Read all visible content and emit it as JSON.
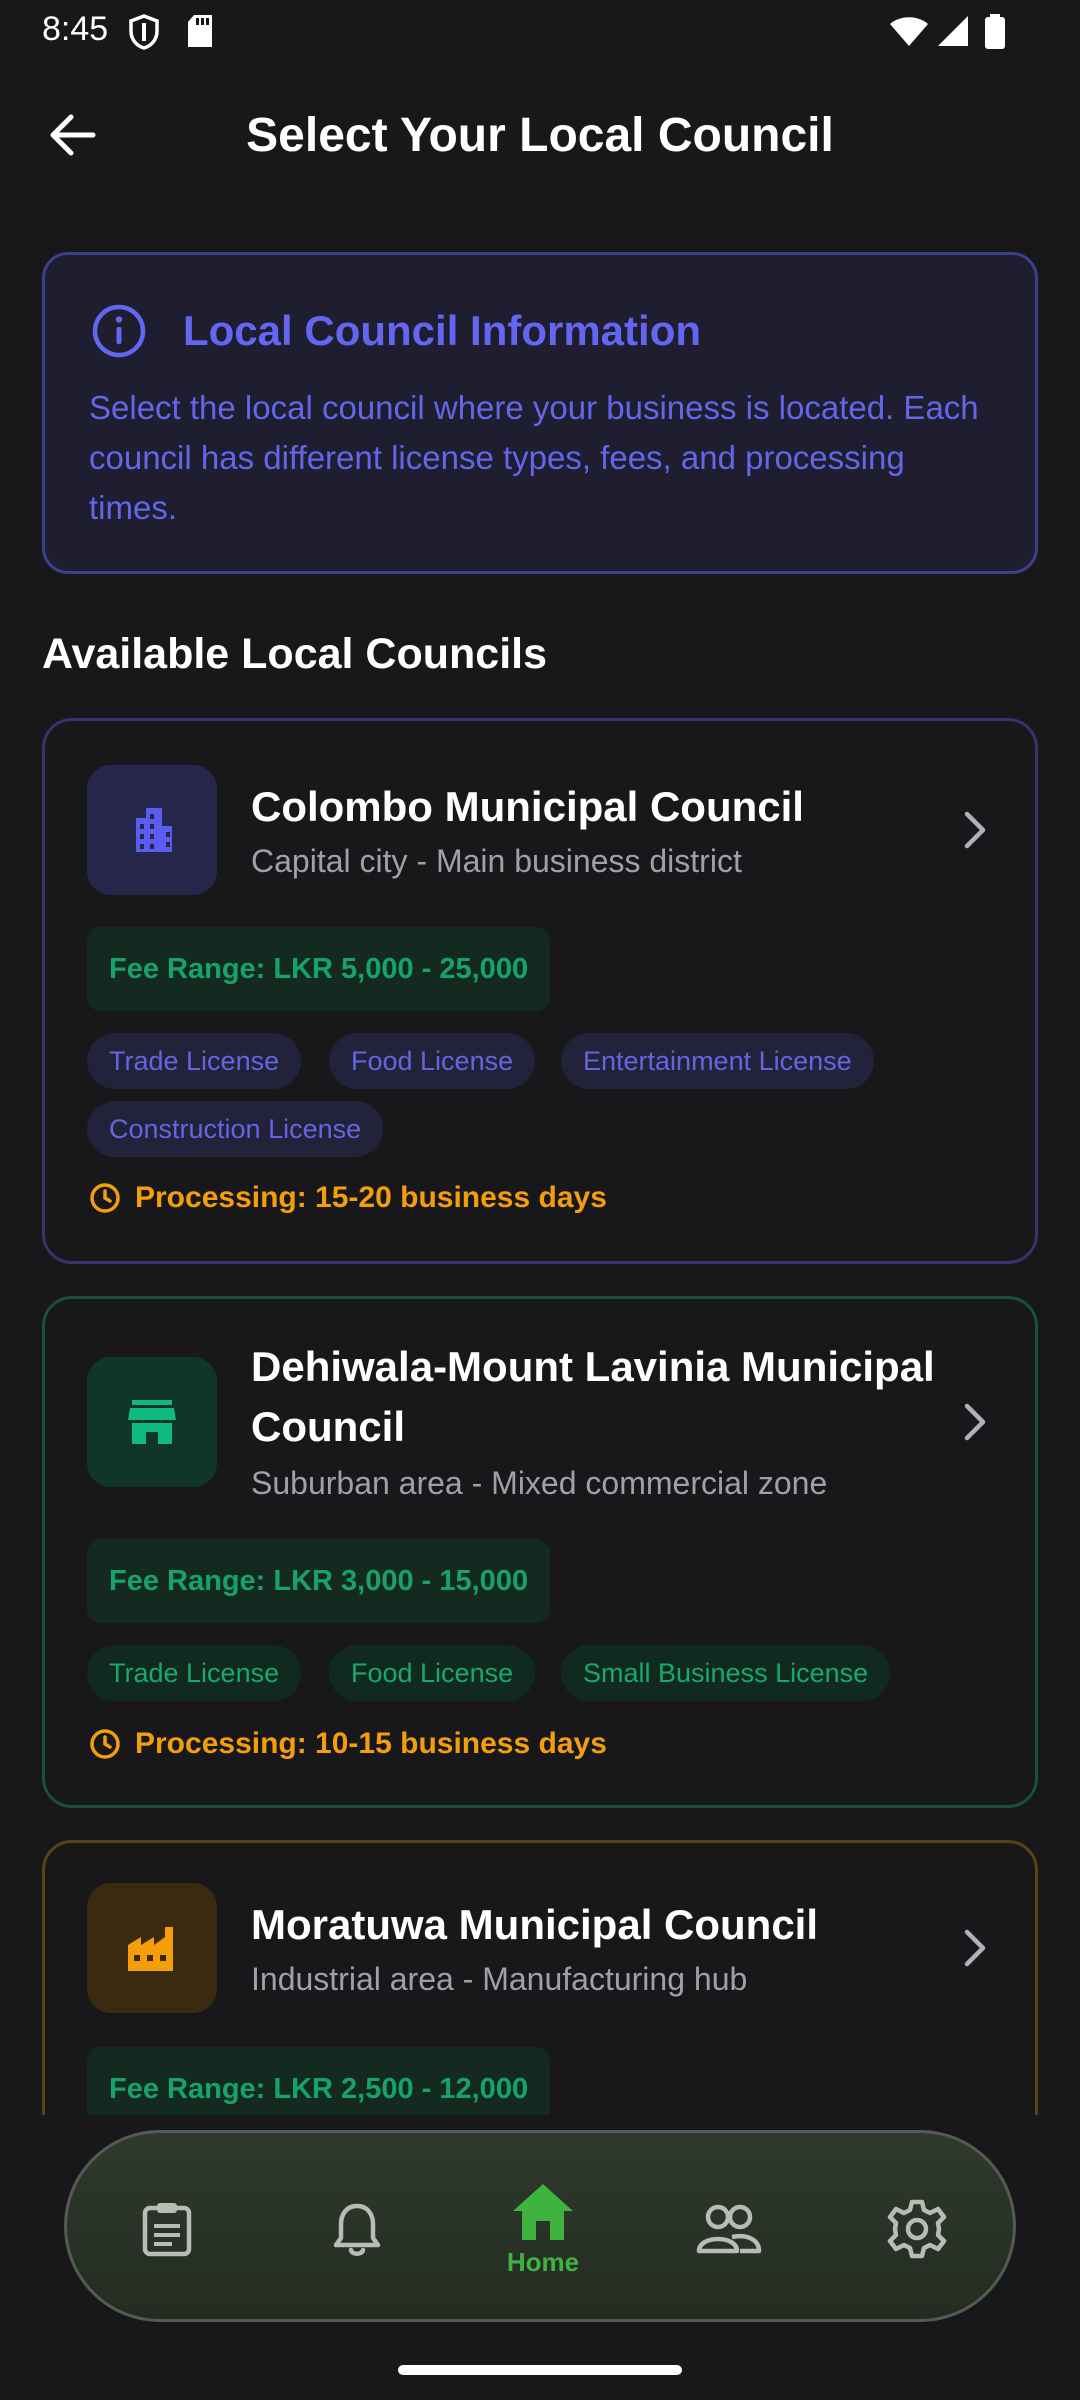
{
  "status_bar": {
    "time": "8:45",
    "icons": [
      "shield-icon",
      "sd-card-icon",
      "wifi-icon",
      "signal-icon",
      "battery-icon"
    ]
  },
  "app_bar": {
    "title": "Select Your Local Council",
    "back_icon": "arrow-left-icon"
  },
  "info_card": {
    "icon": "info-circle-icon",
    "title": "Local Council Information",
    "text": "Select the local council where your business is located. Each council has different license types, fees, and processing times."
  },
  "section_heading": "Available Local Councils",
  "councils": [
    {
      "icon": "building-icon",
      "name": "Colombo Municipal Council",
      "description": "Capital city - Main business district",
      "fee_range": "Fee Range: LKR 5,000 - 25,000",
      "licenses": [
        "Trade License",
        "Food License",
        "Entertainment License",
        "Construction License"
      ],
      "processing": "Processing: 15-20 business days",
      "accent": "#6366f1"
    },
    {
      "icon": "store-icon",
      "name": "Dehiwala-Mount Lavinia Municipal Council",
      "description": "Suburban area - Mixed commercial zone",
      "fee_range": "Fee Range: LKR 3,000 - 15,000",
      "licenses": [
        "Trade License",
        "Food License",
        "Small Business License"
      ],
      "processing": "Processing: 10-15 business days",
      "accent": "#10b981"
    },
    {
      "icon": "factory-icon",
      "name": "Moratuwa Municipal Council",
      "description": "Industrial area - Manufacturing hub",
      "fee_range": "Fee Range: LKR 2,500 - 12,000",
      "accent": "#f59e0b"
    }
  ],
  "bottom_nav": {
    "items": [
      {
        "icon": "clipboard-icon",
        "label": ""
      },
      {
        "icon": "bell-icon",
        "label": ""
      },
      {
        "icon": "home-icon",
        "label": "Home",
        "active": true
      },
      {
        "icon": "people-icon",
        "label": ""
      },
      {
        "icon": "gear-icon",
        "label": ""
      }
    ],
    "active_color": "#3fb33f"
  }
}
